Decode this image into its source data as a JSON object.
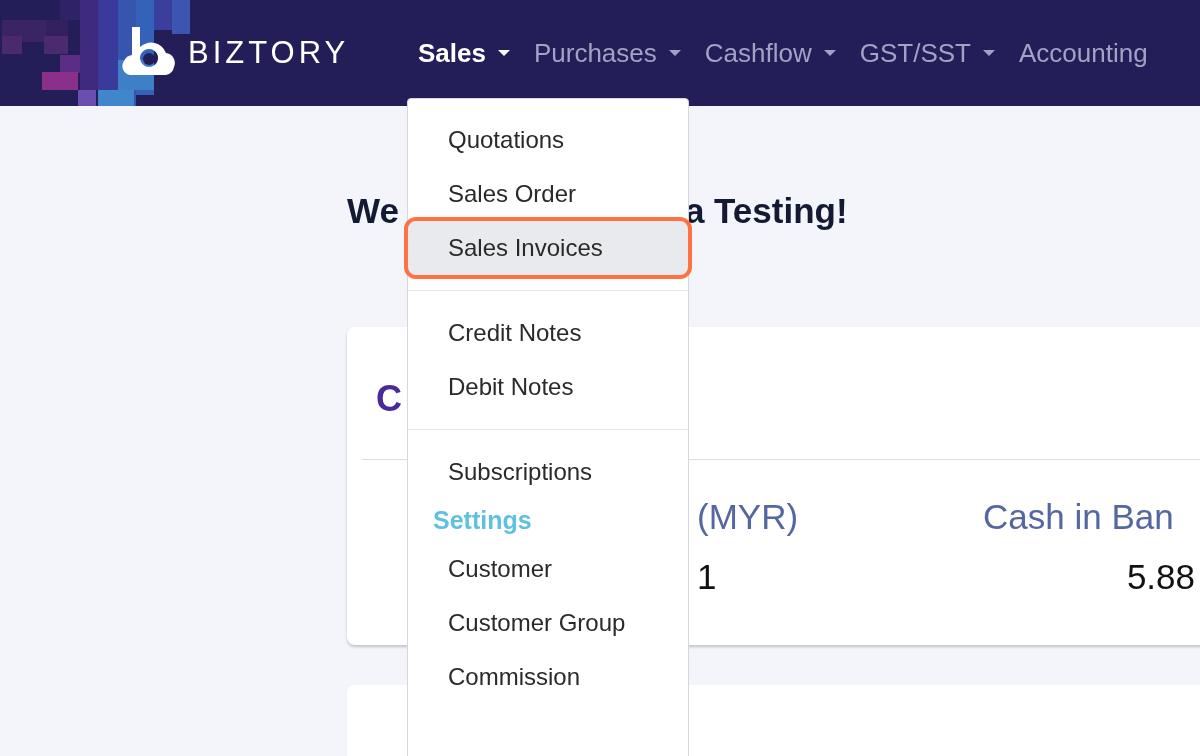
{
  "navbar": {
    "brand": "BIZTORY",
    "menu": [
      {
        "label": "Sales",
        "selected": true,
        "has_caret": true
      },
      {
        "label": "Purchases",
        "selected": false,
        "has_caret": true
      },
      {
        "label": "Cashflow",
        "selected": false,
        "has_caret": true
      },
      {
        "label": "GST/SST",
        "selected": false,
        "has_caret": true
      },
      {
        "label": "Accounting",
        "selected": false,
        "has_caret": false
      }
    ]
  },
  "welcome": {
    "start": "We",
    "end": "a Testing!"
  },
  "card": {
    "title": "C",
    "columns": [
      {
        "label": "(MYR)",
        "value": "1"
      },
      {
        "label": "Cash in Ban",
        "value": "5.88"
      }
    ]
  },
  "dropdown": {
    "items": [
      {
        "kind": "item",
        "label": "Quotations",
        "selected": false
      },
      {
        "kind": "item",
        "label": "Sales Order",
        "selected": false
      },
      {
        "kind": "item",
        "label": "Sales Invoices",
        "selected": true
      },
      {
        "kind": "divider"
      },
      {
        "kind": "item",
        "label": "Credit Notes",
        "selected": false
      },
      {
        "kind": "item",
        "label": "Debit Notes",
        "selected": false
      },
      {
        "kind": "divider"
      },
      {
        "kind": "item",
        "label": "Subscriptions",
        "selected": false
      },
      {
        "kind": "header",
        "label": "Settings"
      },
      {
        "kind": "item",
        "label": "Customer",
        "selected": false
      },
      {
        "kind": "item",
        "label": "Customer Group",
        "selected": false
      },
      {
        "kind": "item",
        "label": "Commission",
        "selected": false
      }
    ]
  }
}
